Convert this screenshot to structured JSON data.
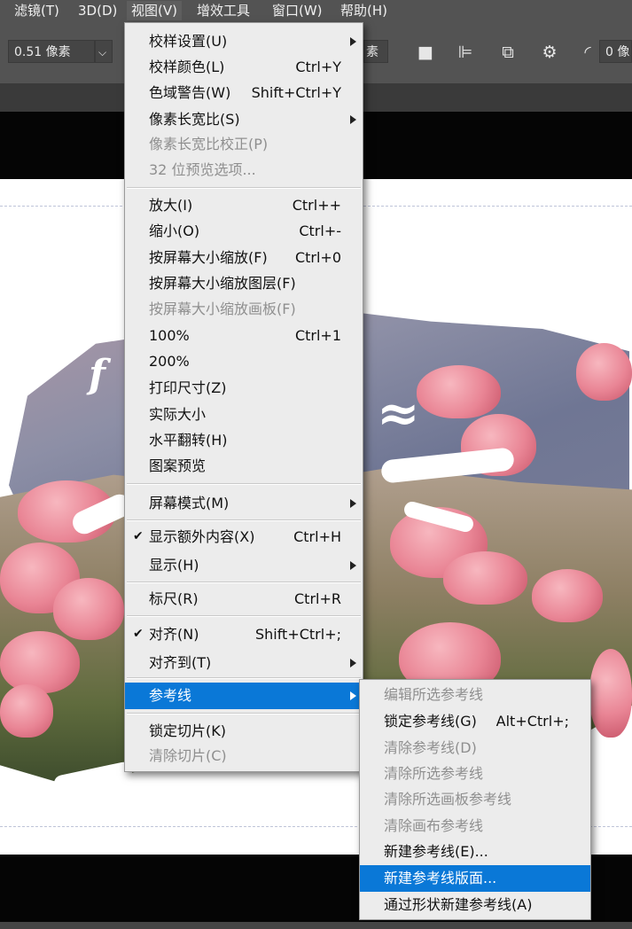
{
  "menubar": {
    "items": [
      {
        "label": "滤镜(T)"
      },
      {
        "label": "3D(D)"
      },
      {
        "label": "视图(V)"
      },
      {
        "label": "增效工具"
      },
      {
        "label": "窗口(W)"
      },
      {
        "label": "帮助(H)"
      }
    ]
  },
  "options_bar": {
    "width_value": "0.51 像素",
    "dropdown_arrow": "⌵",
    "partial_field": "素",
    "partial_right_field": "0 像"
  },
  "view_menu": {
    "items": [
      {
        "label": "校样设置(U)",
        "shortcut": ""
      },
      {
        "label": "校样颜色(L)",
        "shortcut": "Ctrl+Y"
      },
      {
        "label": "色域警告(W)",
        "shortcut": "Shift+Ctrl+Y"
      },
      {
        "label": "像素长宽比(S)",
        "shortcut": ""
      },
      {
        "label": "像素长宽比校正(P)",
        "shortcut": ""
      },
      {
        "label": "32 位预览选项...",
        "shortcut": ""
      },
      {
        "label": "放大(I)",
        "shortcut": "Ctrl++"
      },
      {
        "label": "缩小(O)",
        "shortcut": "Ctrl+-"
      },
      {
        "label": "按屏幕大小缩放(F)",
        "shortcut": "Ctrl+0"
      },
      {
        "label": "按屏幕大小缩放图层(F)",
        "shortcut": ""
      },
      {
        "label": "按屏幕大小缩放画板(F)",
        "shortcut": ""
      },
      {
        "label": "100%",
        "shortcut": "Ctrl+1"
      },
      {
        "label": "200%",
        "shortcut": ""
      },
      {
        "label": "打印尺寸(Z)",
        "shortcut": ""
      },
      {
        "label": "实际大小",
        "shortcut": ""
      },
      {
        "label": "水平翻转(H)",
        "shortcut": ""
      },
      {
        "label": "图案预览",
        "shortcut": ""
      },
      {
        "label": "屏幕模式(M)",
        "shortcut": ""
      },
      {
        "label": "显示额外内容(X)",
        "shortcut": "Ctrl+H",
        "check": "✔"
      },
      {
        "label": "显示(H)",
        "shortcut": ""
      },
      {
        "label": "标尺(R)",
        "shortcut": "Ctrl+R"
      },
      {
        "label": "对齐(N)",
        "shortcut": "Shift+Ctrl+;",
        "check": "✔"
      },
      {
        "label": "对齐到(T)",
        "shortcut": ""
      },
      {
        "label": "参考线",
        "shortcut": ""
      },
      {
        "label": "锁定切片(K)",
        "shortcut": ""
      },
      {
        "label": "清除切片(C)",
        "shortcut": ""
      }
    ]
  },
  "guides_submenu": {
    "items": [
      {
        "label": "编辑所选参考线",
        "shortcut": ""
      },
      {
        "label": "锁定参考线(G)",
        "shortcut": "Alt+Ctrl+;"
      },
      {
        "label": "清除参考线(D)",
        "shortcut": ""
      },
      {
        "label": "清除所选参考线",
        "shortcut": ""
      },
      {
        "label": "清除所选画板参考线",
        "shortcut": ""
      },
      {
        "label": "清除画布参考线",
        "shortcut": ""
      },
      {
        "label": "新建参考线(E)...",
        "shortcut": ""
      },
      {
        "label": "新建参考线版面...",
        "shortcut": ""
      },
      {
        "label": "通过形状新建参考线(A)",
        "shortcut": ""
      }
    ]
  },
  "colors": {
    "menu_bg": "#ececec",
    "highlight": "#0a78d7",
    "disabled_text": "#8f8f8f",
    "app_chrome": "#535353"
  }
}
